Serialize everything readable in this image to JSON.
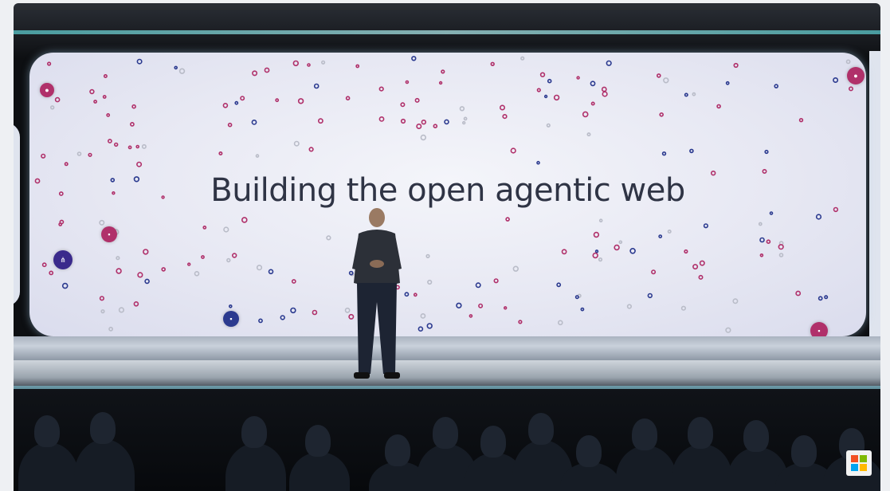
{
  "screen": {
    "headline": "Building the open agentic web"
  },
  "colors": {
    "screen_bg": "#e8e9f4",
    "headline_text": "#2f3445",
    "dot_navy": "#2b3a8f",
    "dot_magenta": "#b0306a",
    "dot_gray": "#b9bcc8",
    "chip_purple": "#3a2a8c",
    "stage_glow": "#59c6c9"
  },
  "icons": {
    "corner_logo": "microsoft-logo-icon",
    "chips": [
      "app-chip-icon",
      "share-chip-icon",
      "document-chip-icon",
      "bell-chip-icon"
    ]
  },
  "logo_colors": [
    "#f25022",
    "#7fba00",
    "#00a4ef",
    "#ffb900"
  ]
}
